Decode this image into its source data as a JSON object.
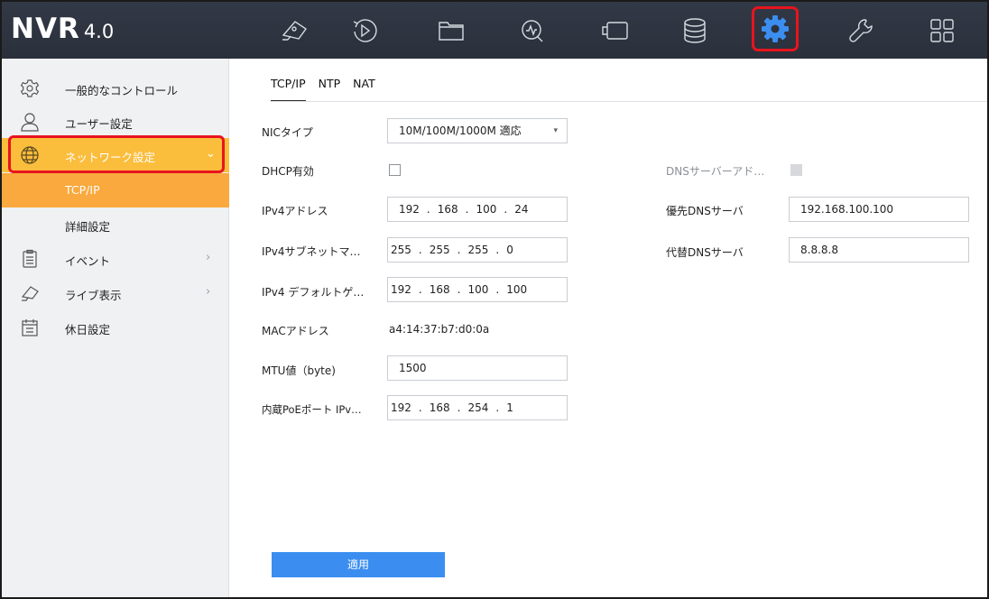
{
  "app": {
    "logo": "NVR",
    "version": "4.0"
  },
  "topnav": {
    "icons": [
      {
        "name": "live-view-icon"
      },
      {
        "name": "playback-icon"
      },
      {
        "name": "file-management-icon"
      },
      {
        "name": "smart-analysis-icon"
      },
      {
        "name": "camera-icon"
      },
      {
        "name": "storage-icon"
      },
      {
        "name": "configuration-icon",
        "active": true
      },
      {
        "name": "maintenance-icon"
      },
      {
        "name": "menu-grid-icon"
      }
    ],
    "active_color": "#3b8ef0",
    "highlight_color": "#e8141e"
  },
  "sidebar": {
    "items": [
      {
        "label": "一般的なコントロール",
        "icon": "gear-icon"
      },
      {
        "label": "ユーザー設定",
        "icon": "user-icon"
      },
      {
        "label": "ネットワーク設定",
        "icon": "globe-icon",
        "active": true
      },
      {
        "label": "TCP/IP",
        "sub": true,
        "active": true
      },
      {
        "label": "詳細設定",
        "sub": true
      },
      {
        "label": "イベント",
        "icon": "clipboard-icon",
        "chevron": "›"
      },
      {
        "label": "ライブ表示",
        "icon": "camera-icon",
        "chevron": "›"
      },
      {
        "label": "休日設定",
        "icon": "calendar-icon"
      }
    ],
    "expand_chevron": "⌄"
  },
  "tabs": [
    {
      "label": "TCP/IP",
      "active": true
    },
    {
      "label": "NTP"
    },
    {
      "label": "NAT"
    }
  ],
  "form": {
    "nic_type": {
      "label": "NICタイプ",
      "value": "10M/100M/1000M 適応"
    },
    "dhcp": {
      "label": "DHCP有効",
      "checked": false
    },
    "dns_auto": {
      "label": "DNSサーバーアド…",
      "checked": false,
      "disabled": true
    },
    "ipv4_address": {
      "label": "IPv4アドレス",
      "octets": [
        "192",
        "168",
        "100",
        "24"
      ]
    },
    "ipv4_subnet": {
      "label": "IPv4サブネットマ…",
      "octets": [
        "255",
        "255",
        "255",
        "0"
      ]
    },
    "ipv4_gateway": {
      "label": "IPv4 デフォルトゲ…",
      "octets": [
        "192",
        "168",
        "100",
        "100"
      ]
    },
    "mac": {
      "label": "MACアドレス",
      "value": "a4:14:37:b7:d0:0a"
    },
    "mtu": {
      "label": "MTU値（byte)",
      "value": "1500"
    },
    "poe_ip": {
      "label": "内蔵PoEポート IPv…",
      "octets": [
        "192",
        "168",
        "254",
        "1"
      ]
    },
    "dns_primary": {
      "label": "優先DNSサーバ",
      "value": "192.168.100.100"
    },
    "dns_secondary": {
      "label": "代替DNSサーバ",
      "value": "8.8.8.8"
    },
    "ip_separator": "."
  },
  "apply_label": "適用"
}
